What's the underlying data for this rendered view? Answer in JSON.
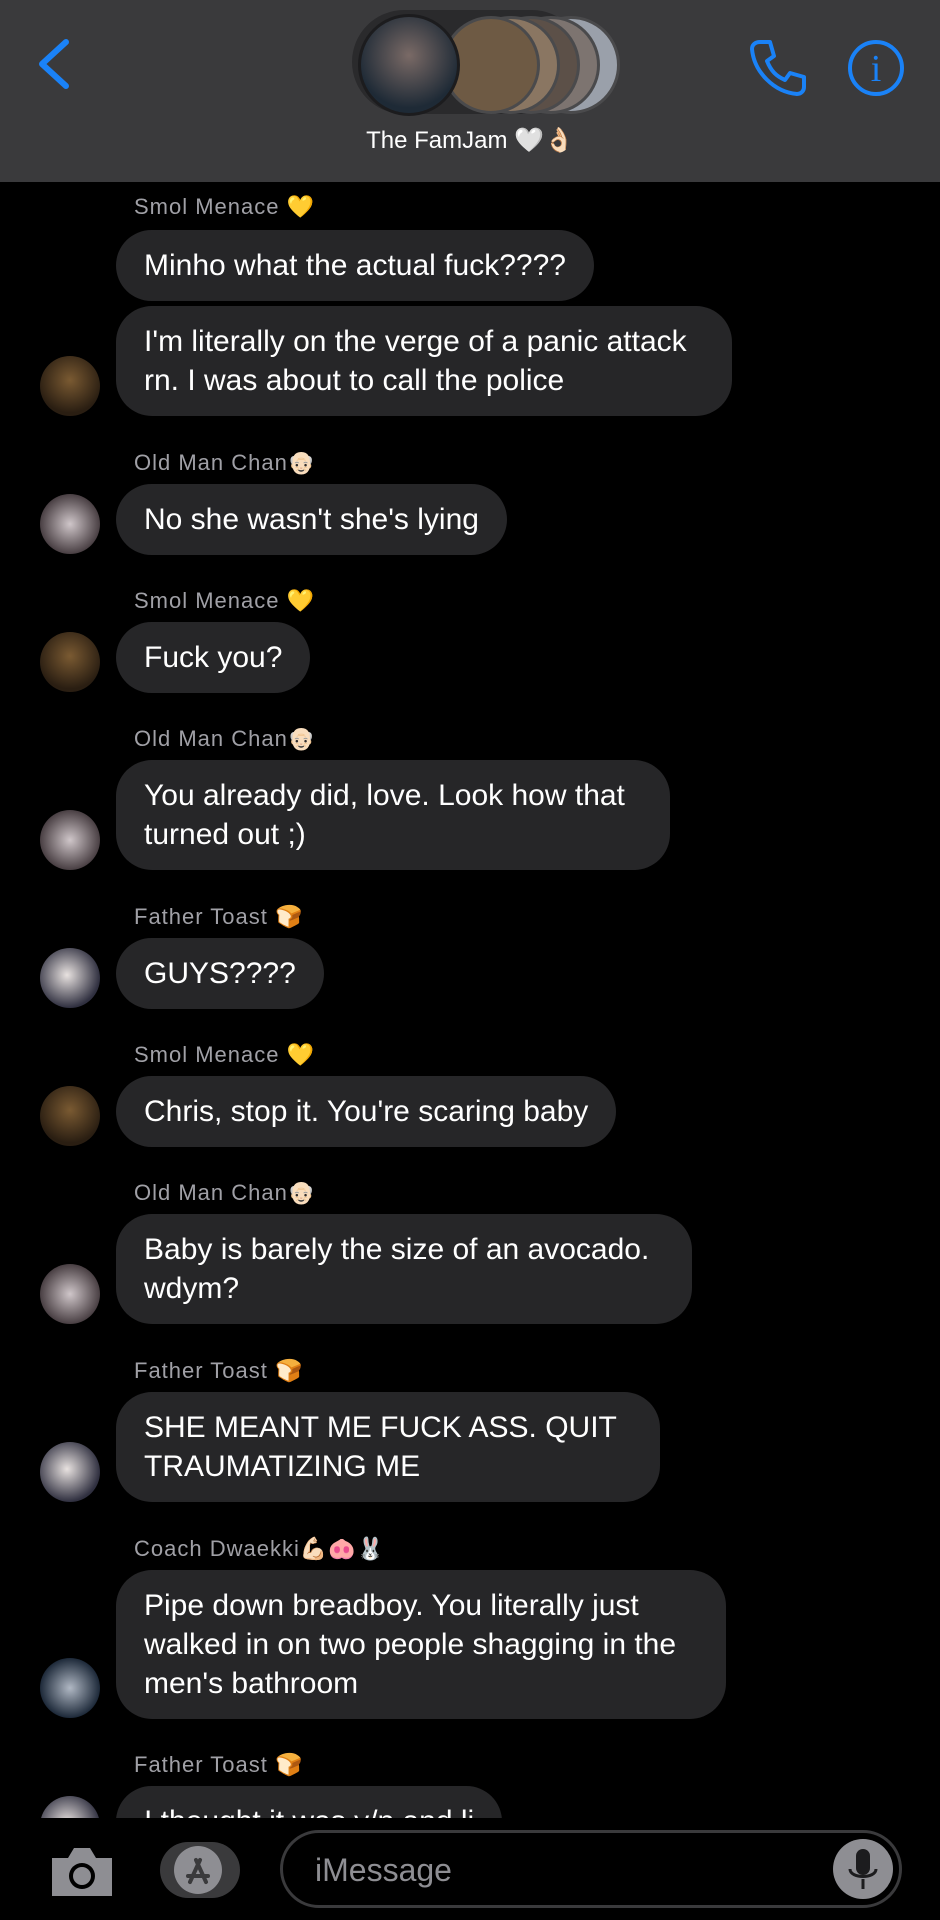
{
  "header": {
    "title": "The FamJam",
    "title_emoji": "🤍👌🏻",
    "accent": "#1a82f7"
  },
  "messages": [
    {
      "sender": "Smol Menace",
      "sender_emoji": "💛",
      "avatar": "menace",
      "bubbles": [
        "Minho what the actual fuck????",
        "I'm literally on the verge of a panic attack rn. I was about to call the police"
      ]
    },
    {
      "sender": "Old Man Chan",
      "sender_emoji": "👴🏻",
      "avatar": "chan",
      "bubbles": [
        "No she wasn't she's lying"
      ]
    },
    {
      "sender": "Smol Menace",
      "sender_emoji": "💛",
      "avatar": "menace",
      "bubbles": [
        "Fuck you?"
      ]
    },
    {
      "sender": "Old Man Chan",
      "sender_emoji": "👴🏻",
      "avatar": "chan",
      "bubbles": [
        "You already did, love. Look how that turned out ;)"
      ]
    },
    {
      "sender": "Father Toast",
      "sender_emoji": "🍞",
      "avatar": "toast",
      "bubbles": [
        "GUYS????"
      ]
    },
    {
      "sender": "Smol Menace",
      "sender_emoji": "💛",
      "avatar": "menace",
      "bubbles": [
        "Chris, stop it. You're scaring baby"
      ]
    },
    {
      "sender": "Old Man Chan",
      "sender_emoji": "👴🏻",
      "avatar": "chan",
      "bubbles": [
        "Baby is barely the size of an avocado. wdym?"
      ]
    },
    {
      "sender": "Father Toast",
      "sender_emoji": "🍞",
      "avatar": "toast",
      "bubbles": [
        "SHE MEANT ME FUCK ASS. QUIT TRAUMATIZING ME"
      ]
    },
    {
      "sender": "Coach Dwaekki",
      "sender_emoji": "💪🏻🐽🐰",
      "avatar": "coach",
      "bubbles": [
        "Pipe down breadboy. You literally just walked in on two people shagging in the men's bathroom"
      ]
    },
    {
      "sender": "Father Toast",
      "sender_emoji": "🍞",
      "avatar": "toast",
      "bubbles": [
        "I thought it was y/n and li"
      ]
    }
  ],
  "input": {
    "placeholder": "iMessage"
  },
  "icons": {
    "back": "chevron-left-icon",
    "call": "phone-icon",
    "info": "info-icon",
    "camera": "camera-icon",
    "apps": "app-store-icon",
    "mic": "microphone-icon"
  }
}
